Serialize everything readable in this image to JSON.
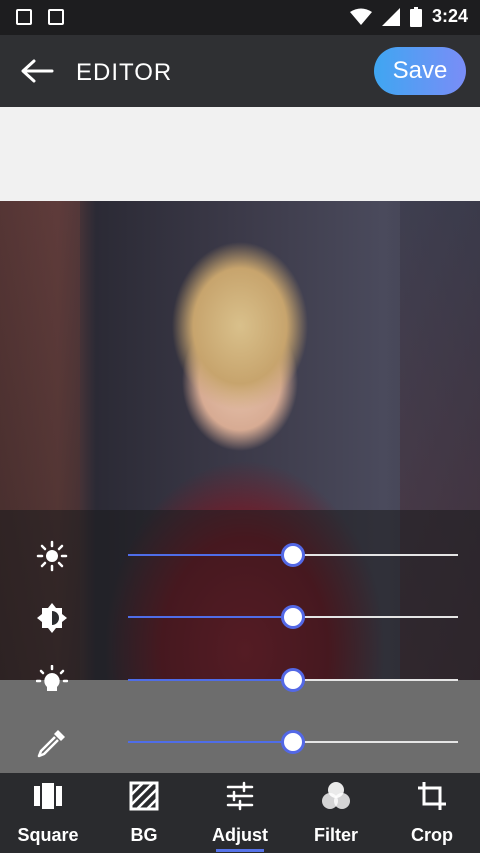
{
  "status": {
    "time": "3:24"
  },
  "appbar": {
    "title": "EDITOR",
    "save_label": "Save"
  },
  "sliders": [
    {
      "name": "brightness",
      "icon": "brightness-icon",
      "value": 0.5
    },
    {
      "name": "contrast",
      "icon": "contrast-icon",
      "value": 0.5
    },
    {
      "name": "saturation",
      "icon": "lightbulb-icon",
      "value": 0.5
    },
    {
      "name": "color",
      "icon": "eyedropper-icon",
      "value": 0.5
    }
  ],
  "nav": {
    "items": [
      {
        "label": "Square",
        "icon": "square-icon",
        "active": false
      },
      {
        "label": "BG",
        "icon": "background-pattern-icon",
        "active": false
      },
      {
        "label": "Adjust",
        "icon": "sliders-icon",
        "active": true
      },
      {
        "label": "Filter",
        "icon": "filter-icon",
        "active": false
      },
      {
        "label": "Crop",
        "icon": "crop-icon",
        "active": false
      }
    ]
  },
  "colors": {
    "accent": "#5368e6",
    "save_gradient_start": "#3fa6f1",
    "save_gradient_end": "#7a8df7"
  }
}
